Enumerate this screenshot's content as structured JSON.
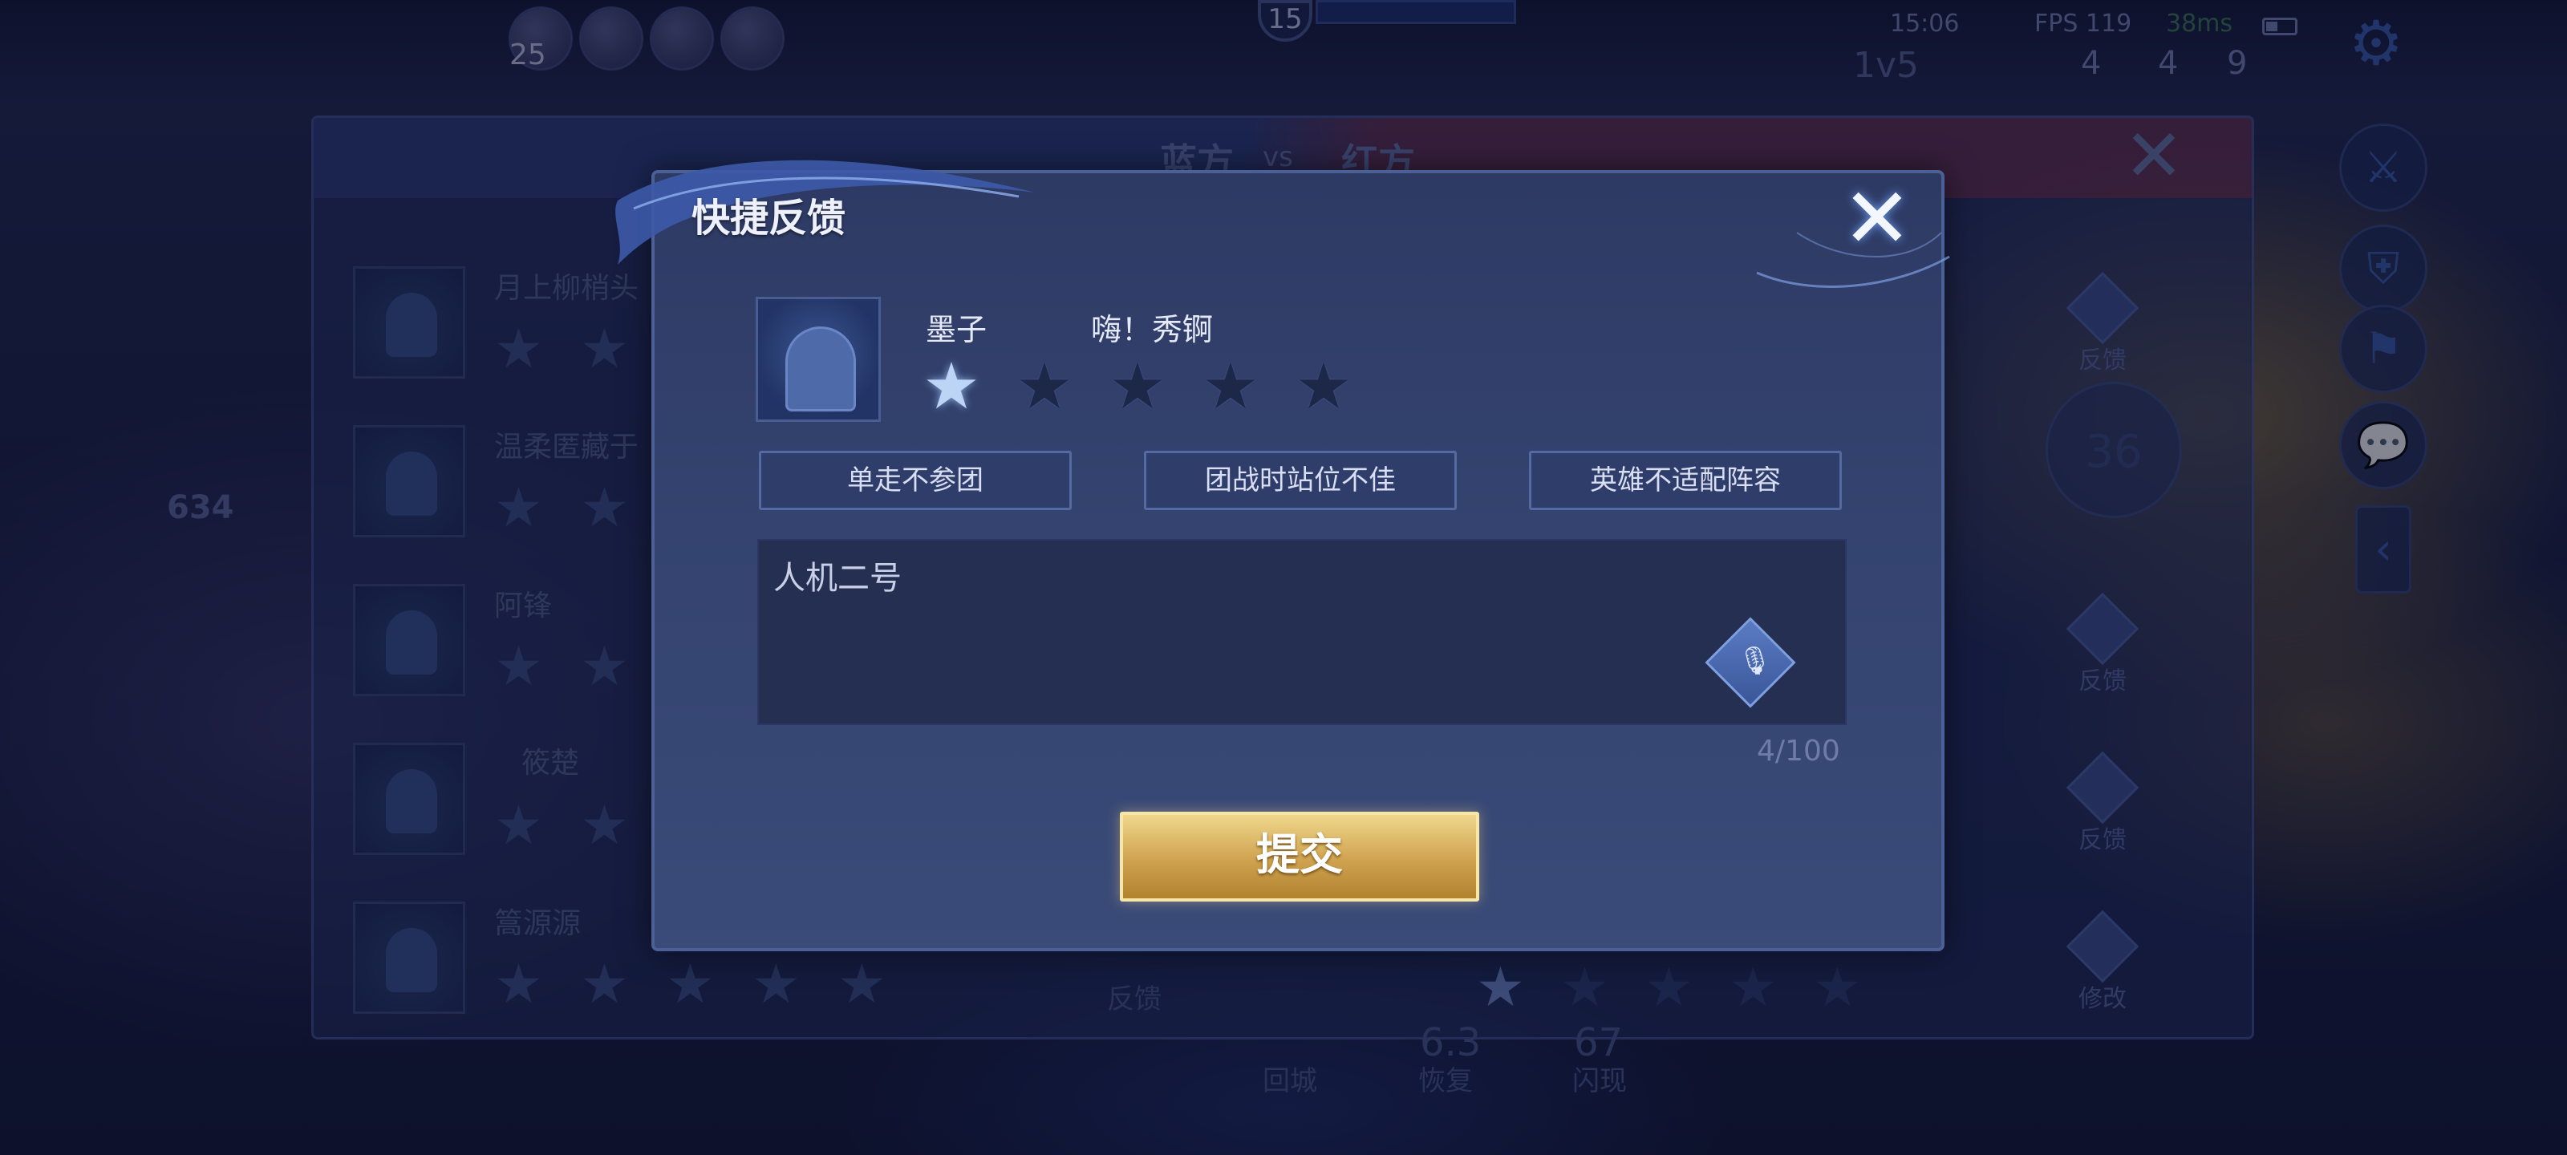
{
  "hud": {
    "level": "25",
    "timer": "15",
    "clock": "15:06",
    "fps": "FPS 119",
    "ping": "38ms",
    "score_prefix": "1v5",
    "kda": [
      "4",
      "4",
      "9"
    ]
  },
  "scoreboard": {
    "team_blue": "蓝方",
    "vs": "vs",
    "team_red": "红方",
    "close_icon": "close-icon",
    "gold": "634",
    "players": [
      {
        "name": "月上柳梢头"
      },
      {
        "name": "温柔匿藏于"
      },
      {
        "name": "阿锋"
      },
      {
        "name": "筱楚"
      },
      {
        "name": "篙源源"
      }
    ],
    "feedback_label": "反馈",
    "modify_label": "修改",
    "center_feedback": "反馈",
    "number_36": "36",
    "skills": {
      "recall": "回城",
      "heal": "恢复",
      "flash": "闪现",
      "heal_cd": "6.3",
      "flash_cd": "67"
    }
  },
  "dialog": {
    "title": "快捷反馈",
    "close_icon": "close-icon",
    "player": {
      "name": "墨子",
      "hero_nickname": "嗨！秀锕",
      "rating": 1,
      "rating_max": 5
    },
    "tags": [
      "单走不参团",
      "团战时站位不佳",
      "英雄不适配阵容"
    ],
    "comment": "人机二号",
    "char_count": "4/100",
    "mic_icon": "voice-input-icon",
    "submit_label": "提交"
  },
  "colors": {
    "submit_gold": "#cfa24f",
    "dialog_bg": "#34436f",
    "star_active": "#bcd4f5"
  }
}
